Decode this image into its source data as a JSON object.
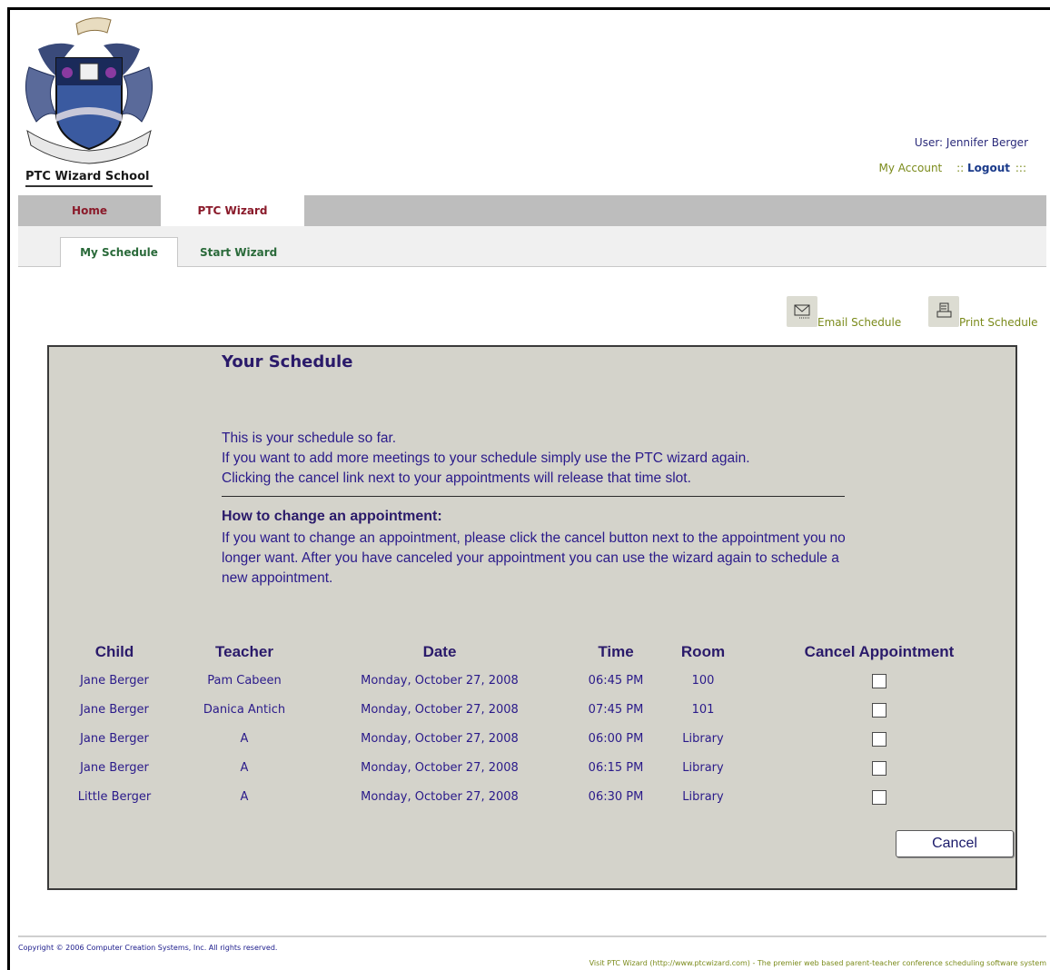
{
  "header": {
    "school_name": "PTC Wizard School",
    "user_label": "User: Jennifer Berger",
    "my_account": "My Account",
    "separator": "::",
    "logout": "Logout",
    "logout_suffix": ":::"
  },
  "tabs": [
    {
      "label": "Home",
      "active": false
    },
    {
      "label": "PTC Wizard",
      "active": true
    }
  ],
  "subtabs": [
    {
      "label": "My Schedule",
      "active": true
    },
    {
      "label": "Start Wizard",
      "active": false
    }
  ],
  "actions": {
    "email": "Email Schedule",
    "print": "Print Schedule"
  },
  "panel": {
    "title": "Your Schedule",
    "intro": [
      "This is your schedule so far.",
      "If you want to add more meetings to your schedule simply use the PTC wizard again.",
      "Clicking the cancel link next to your appointments will release that time slot."
    ],
    "how_title": "How to change an appointment:",
    "how_text": "If you want to change an appointment, please click the cancel button next to the appointment you no longer want. After you have canceled your appointment you can use the wizard again to schedule a new appointment."
  },
  "table": {
    "headers": {
      "child": "Child",
      "teacher": "Teacher",
      "date": "Date",
      "time": "Time",
      "room": "Room",
      "cancel": "Cancel Appointment"
    },
    "rows": [
      {
        "child": "Jane Berger",
        "teacher": "Pam Cabeen",
        "date": "Monday, October 27, 2008",
        "time": "06:45 PM",
        "room": "100"
      },
      {
        "child": "Jane Berger",
        "teacher": "Danica Antich",
        "date": "Monday, October 27, 2008",
        "time": "07:45 PM",
        "room": "101"
      },
      {
        "child": "Jane Berger",
        "teacher": "A",
        "date": "Monday, October 27, 2008",
        "time": "06:00 PM",
        "room": "Library"
      },
      {
        "child": "Jane Berger",
        "teacher": "A",
        "date": "Monday, October 27, 2008",
        "time": "06:15 PM",
        "room": "Library"
      },
      {
        "child": "Little Berger",
        "teacher": "A",
        "date": "Monday, October 27, 2008",
        "time": "06:30 PM",
        "room": "Library"
      }
    ]
  },
  "cancel_button": "Cancel",
  "footer": {
    "copyright": "Copyright © 2006 Computer Creation Systems, Inc. All rights reserved.",
    "visit": "Visit PTC Wizard (http://www.ptcwizard.com) - The premier web based parent-teacher conference scheduling software system"
  },
  "icons": {
    "email": "envelope-icon",
    "print": "printer-icon",
    "logo": "school-crest-logo"
  }
}
